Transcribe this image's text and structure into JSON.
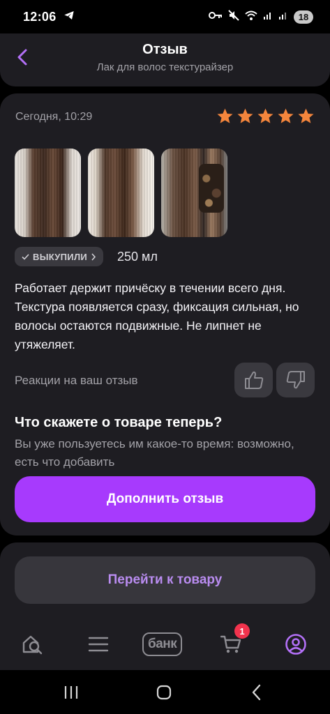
{
  "status_bar": {
    "time": "12:06",
    "battery": "18",
    "icons": [
      "telegram-icon",
      "key-icon",
      "mute-icon",
      "wifi-icon",
      "signal-icon",
      "signal-icon"
    ]
  },
  "header": {
    "title": "Отзыв",
    "subtitle": "Лак для волос текстурайзер",
    "back_icon": "chevron-left-icon"
  },
  "review": {
    "date": "Сегодня, 10:29",
    "rating": 5,
    "rating_max": 5,
    "photos_count": 3,
    "badge_label": "ВЫКУПИЛИ",
    "volume": "250 мл",
    "text": "Работает держит причёску в течении всего дня. Текстура появляется сразу, фиксация сильная, но волосы остаются подвижные. Не липнет не утяжеляет.",
    "reactions_label": "Реакции на ваш отзыв"
  },
  "followup": {
    "title": "Что скажете о товаре теперь?",
    "subtitle": "Вы уже пользуетесь им какое-то время: возможно, есть что добавить",
    "button": "Дополнить отзыв"
  },
  "go_to_product": {
    "button": "Перейти к товару"
  },
  "tabbar": {
    "bank_label": "банк",
    "cart_count": "1"
  },
  "colors": {
    "accent": "#a73afd",
    "star": "#f4853c",
    "card_bg": "#1e1d22",
    "badge_red": "#f2334d",
    "secondary_text": "#b98cf0"
  }
}
